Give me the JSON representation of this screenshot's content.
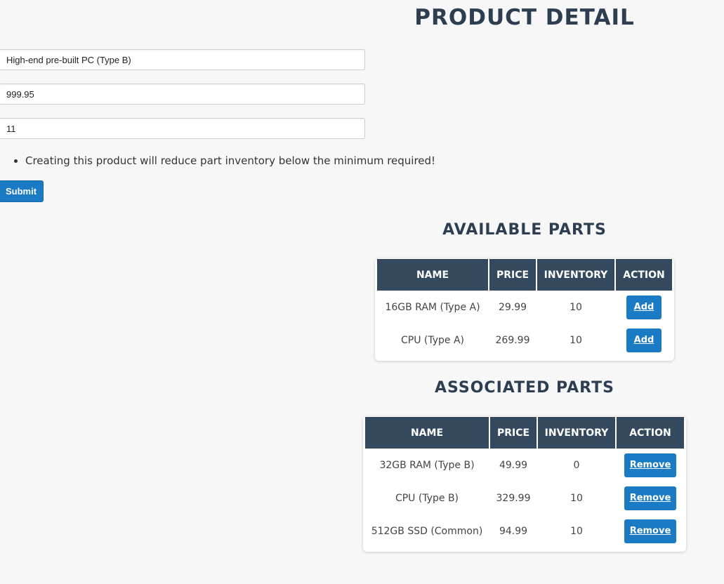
{
  "page": {
    "title": "PRODUCT DETAIL"
  },
  "form": {
    "name_value": "High-end pre-built PC (Type B)",
    "price_value": "999.95",
    "inventory_value": "11",
    "errors": [
      "Creating this product will reduce part inventory below the minimum required!"
    ],
    "submit_label": "Submit"
  },
  "available_parts": {
    "title": "AVAILABLE PARTS",
    "headers": {
      "name": "NAME",
      "price": "PRICE",
      "inventory": "INVENTORY",
      "action": "ACTION"
    },
    "rows": [
      {
        "name": "16GB RAM (Type A)",
        "price": "29.99",
        "inventory": "10",
        "action": "Add"
      },
      {
        "name": "CPU (Type A)",
        "price": "269.99",
        "inventory": "10",
        "action": "Add"
      }
    ]
  },
  "associated_parts": {
    "title": "ASSOCIATED PARTS",
    "headers": {
      "name": "NAME",
      "price": "PRICE",
      "inventory": "INVENTORY",
      "action": "ACTION"
    },
    "rows": [
      {
        "name": "32GB RAM (Type B)",
        "price": "49.99",
        "inventory": "0",
        "action": "Remove"
      },
      {
        "name": "CPU (Type B)",
        "price": "329.99",
        "inventory": "10",
        "action": "Remove"
      },
      {
        "name": "512GB SSD (Common)",
        "price": "94.99",
        "inventory": "10",
        "action": "Remove"
      }
    ]
  },
  "colors": {
    "primary_button": "#1a7ac4",
    "table_header": "#34495e",
    "title": "#2c3e50"
  }
}
